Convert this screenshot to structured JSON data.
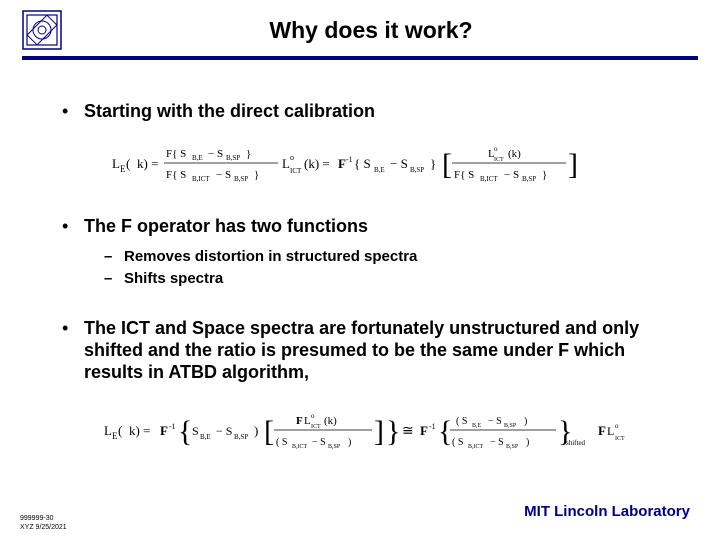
{
  "title": "Why does it work?",
  "bullets": {
    "b1": "Starting with the direct calibration",
    "b2": "The F operator has two functions",
    "b2_subs": {
      "s1": "Removes distortion in structured spectra",
      "s2": "Shifts spectra"
    },
    "b3": "The ICT and Space spectra are fortunately unstructured and only shifted and the ratio is presumed to be the same under F which results in ATBD algorithm,"
  },
  "footer": {
    "code": "999999-30",
    "date": "XYZ 9/25/2021",
    "lab": "MIT Lincoln Laboratory"
  },
  "eq1": {
    "lhs": "L_E(k)",
    "num1": "F{ S_{B,E} − S_{B,SP} }",
    "den1": "F{ S_{B,ICT} − S_{B,SP} }",
    "mid": "L°_{ICT}(k) = F^{-1}{ S_{B,E} − S_{B,SP} }",
    "frac2top": "L°_{ICT}(k)",
    "frac2bot": "F{ S_{B,ICT} − S_{B,SP} }"
  },
  "eq2": {
    "lhs": "L_E(k)",
    "inv": "F^{-1}",
    "a": "S_{B,E} − S_{B,SP}",
    "b_top": "F L°_{ICT}(k)",
    "b_bot": "( S_{B,ICT} − S_{B,SP} )",
    "approx": "≅ F^{-1}",
    "c_top": "( S_{B,E} − S_{B,SP} )",
    "c_bot": "( S_{B,ICT} − S_{B,SP} )",
    "shifted": "shifted",
    "tail": "F L°_{ICT}"
  }
}
